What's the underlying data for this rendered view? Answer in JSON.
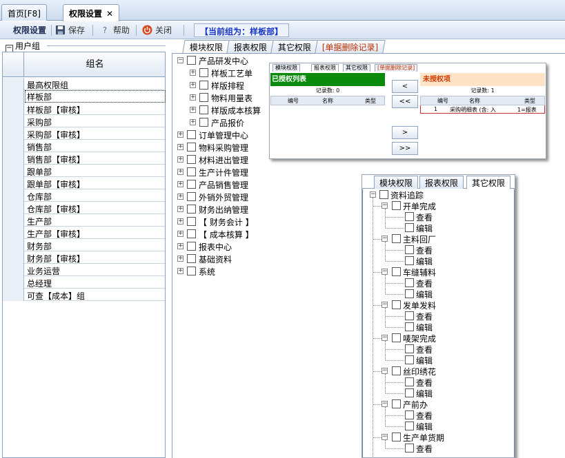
{
  "doc_tabs": [
    {
      "label": "首页[F8]",
      "active": false
    },
    {
      "label": "权限设置",
      "active": true,
      "close": "✕"
    }
  ],
  "toolbar": {
    "title": "权限设置",
    "save": "保存",
    "help": "帮助",
    "close": "关闭",
    "current_group": "【当前组为：样板部】"
  },
  "user_group": {
    "header": "用户组",
    "column": "组名",
    "rows": [
      "最高权限组",
      "样板部",
      "样板部【审核】",
      "采购部",
      "采购部【审核】",
      "销售部",
      "销售部【审核】",
      "跟单部",
      "跟单部【审核】",
      "仓库部",
      "仓库部【审核】",
      "生产部",
      "生产部【审核】",
      "财务部",
      "财务部【审核】",
      "业务运营",
      "总经理",
      "可查【成本】组"
    ],
    "selected_index": 1
  },
  "perm_tabs": [
    "模块权限",
    "报表权限",
    "其它权限",
    "[单据删除记录]"
  ],
  "module_tree": [
    {
      "label": "产品研发中心",
      "level": 0,
      "expanded": true
    },
    {
      "label": "样板工艺单",
      "level": 1
    },
    {
      "label": "样版排程",
      "level": 1
    },
    {
      "label": "物料用量表",
      "level": 1
    },
    {
      "label": "样版成本核算",
      "level": 1
    },
    {
      "label": "产品报价",
      "level": 1
    },
    {
      "label": "订单管理中心",
      "level": 0
    },
    {
      "label": "物料采购管理",
      "level": 0
    },
    {
      "label": "材料进出管理",
      "level": 0
    },
    {
      "label": "生产计件管理",
      "level": 0
    },
    {
      "label": "产品销售管理",
      "level": 0
    },
    {
      "label": "外销外贸管理",
      "level": 0
    },
    {
      "label": "财务出纳管理",
      "level": 0
    },
    {
      "label": "【 财务会计 】",
      "level": 0
    },
    {
      "label": "【 成本核算 】",
      "level": 0
    },
    {
      "label": "报表中心",
      "level": 0
    },
    {
      "label": "基础资料",
      "level": 0
    },
    {
      "label": "系统",
      "level": 0
    }
  ],
  "report_shot": {
    "tabs": [
      "模块权限",
      "报表权限",
      "其它权限",
      "[单据删除记录]"
    ],
    "granted_title": "已授权列表",
    "granted_count": "记录数: 0",
    "granted_cols": [
      "编号",
      "名称",
      "类型"
    ],
    "buttons": [
      "<",
      "<<",
      ">",
      ">>"
    ],
    "ungranted_title": "未授权项",
    "ungranted_count": "记录数: 1",
    "ungranted_cols": [
      "编号",
      "名称",
      "类型"
    ],
    "ungranted_row": {
      "no": "1",
      "name": "采购明细表 (含: 入",
      "type": "1=报表"
    }
  },
  "other_shot": {
    "tabs": [
      "模块权限",
      "报表权限",
      "其它权限"
    ],
    "root": "资料追踪",
    "groups": [
      {
        "label": "开单完成",
        "children": [
          "查看",
          "编辑"
        ]
      },
      {
        "label": "主料回厂",
        "children": [
          "查看",
          "编辑"
        ]
      },
      {
        "label": "车缝辅料",
        "children": [
          "查看",
          "编辑"
        ]
      },
      {
        "label": "发单发料",
        "children": [
          "查看",
          "编辑"
        ]
      },
      {
        "label": "唛架完成",
        "children": [
          "查看",
          "编辑"
        ]
      },
      {
        "label": "丝印绣花",
        "children": [
          "查看",
          "编辑"
        ]
      },
      {
        "label": "产前办",
        "children": [
          "查看",
          "编辑"
        ]
      },
      {
        "label": "生产单货期",
        "children": [
          "查看"
        ]
      }
    ]
  }
}
